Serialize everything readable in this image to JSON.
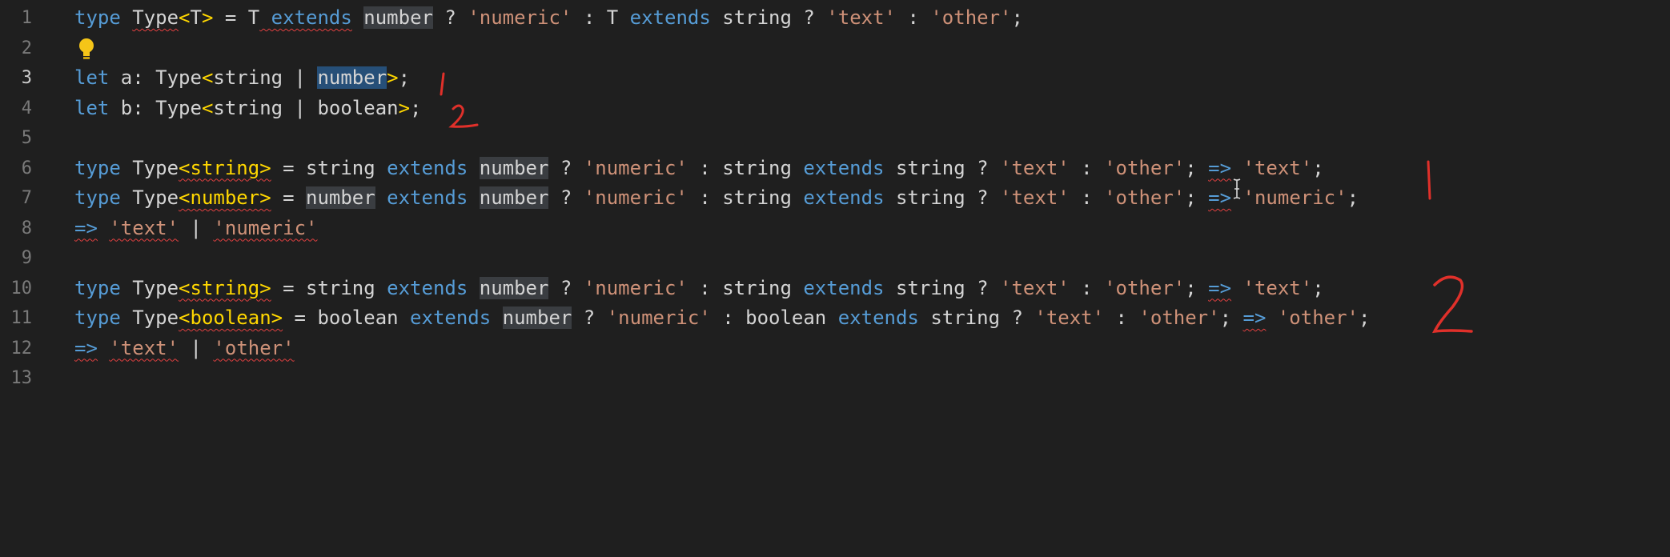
{
  "editor": {
    "top_partial_text": "- - - - - - -",
    "lines": [
      {
        "num": "1",
        "active": false,
        "segments": [
          {
            "t": "type",
            "c": "kw"
          },
          {
            "t": " "
          },
          {
            "t": "Type",
            "c": "tp sq"
          },
          {
            "t": "<",
            "c": "br"
          },
          {
            "t": "T",
            "c": "tp"
          },
          {
            "t": ">",
            "c": "br"
          },
          {
            "t": " = "
          },
          {
            "t": "T",
            "c": "tp"
          },
          {
            "t": " extends",
            "c": "kw sq"
          },
          {
            "t": " "
          },
          {
            "t": "number",
            "c": "hl"
          },
          {
            "t": " ? "
          },
          {
            "t": "'numeric'",
            "c": "str"
          },
          {
            "t": " : "
          },
          {
            "t": "T",
            "c": "tp"
          },
          {
            "t": " "
          },
          {
            "t": "extends",
            "c": "kw"
          },
          {
            "t": " string ? "
          },
          {
            "t": "'text'",
            "c": "str"
          },
          {
            "t": " : "
          },
          {
            "t": "'other'",
            "c": "str"
          },
          {
            "t": ";"
          }
        ]
      },
      {
        "num": "2",
        "active": false,
        "lightbulb": true,
        "segments": []
      },
      {
        "num": "3",
        "active": true,
        "segments": [
          {
            "t": "let",
            "c": "kw"
          },
          {
            "t": " a: "
          },
          {
            "t": "Type",
            "c": "tp"
          },
          {
            "t": "<",
            "c": "br"
          },
          {
            "t": "string | "
          },
          {
            "t": "number",
            "c": "sel"
          },
          {
            "t": ">",
            "c": "br"
          },
          {
            "t": ";"
          }
        ]
      },
      {
        "num": "4",
        "active": false,
        "segments": [
          {
            "t": "let",
            "c": "kw"
          },
          {
            "t": " b: "
          },
          {
            "t": "Type",
            "c": "tp"
          },
          {
            "t": "<",
            "c": "br"
          },
          {
            "t": "string | boolean"
          },
          {
            "t": ">",
            "c": "br"
          },
          {
            "t": ";"
          }
        ]
      },
      {
        "num": "5",
        "active": false,
        "segments": []
      },
      {
        "num": "6",
        "active": false,
        "segments": [
          {
            "t": "type",
            "c": "kw"
          },
          {
            "t": " "
          },
          {
            "t": "Type",
            "c": "tp"
          },
          {
            "t": "<string>",
            "c": "br sq"
          },
          {
            "t": " = string "
          },
          {
            "t": "extends",
            "c": "kw"
          },
          {
            "t": " "
          },
          {
            "t": "number",
            "c": "hl"
          },
          {
            "t": " ? "
          },
          {
            "t": "'numeric'",
            "c": "str"
          },
          {
            "t": " : string "
          },
          {
            "t": "extends",
            "c": "kw"
          },
          {
            "t": " string ? "
          },
          {
            "t": "'text'",
            "c": "str"
          },
          {
            "t": " : "
          },
          {
            "t": "'other'",
            "c": "str"
          },
          {
            "t": "; "
          },
          {
            "t": "=>",
            "c": "kw sq"
          },
          {
            "t": " "
          },
          {
            "t": "'text'",
            "c": "str"
          },
          {
            "t": ";"
          }
        ]
      },
      {
        "num": "7",
        "active": false,
        "segments": [
          {
            "t": "type",
            "c": "kw"
          },
          {
            "t": " "
          },
          {
            "t": "Type",
            "c": "tp"
          },
          {
            "t": "<number>",
            "c": "br sq"
          },
          {
            "t": " = "
          },
          {
            "t": "number",
            "c": "hl"
          },
          {
            "t": " "
          },
          {
            "t": "extends",
            "c": "kw"
          },
          {
            "t": " "
          },
          {
            "t": "number",
            "c": "hl"
          },
          {
            "t": " ? "
          },
          {
            "t": "'numeric'",
            "c": "str"
          },
          {
            "t": " : string "
          },
          {
            "t": "extends",
            "c": "kw"
          },
          {
            "t": " string ? "
          },
          {
            "t": "'text'",
            "c": "str"
          },
          {
            "t": " : "
          },
          {
            "t": "'other'",
            "c": "str"
          },
          {
            "t": "; "
          },
          {
            "t": "=>",
            "c": "kw sq"
          },
          {
            "t": " "
          },
          {
            "t": "'numeric'",
            "c": "str"
          },
          {
            "t": ";"
          }
        ]
      },
      {
        "num": "8",
        "active": false,
        "segments": [
          {
            "t": "=>",
            "c": "kw sq"
          },
          {
            "t": " "
          },
          {
            "t": "'text'",
            "c": "str sq"
          },
          {
            "t": " | "
          },
          {
            "t": "'numeric'",
            "c": "str sq"
          }
        ]
      },
      {
        "num": "9",
        "active": false,
        "segments": []
      },
      {
        "num": "10",
        "active": false,
        "segments": [
          {
            "t": "type",
            "c": "kw"
          },
          {
            "t": " "
          },
          {
            "t": "Type",
            "c": "tp"
          },
          {
            "t": "<string>",
            "c": "br sq"
          },
          {
            "t": " = string "
          },
          {
            "t": "extends",
            "c": "kw"
          },
          {
            "t": " "
          },
          {
            "t": "number",
            "c": "hl"
          },
          {
            "t": " ? "
          },
          {
            "t": "'numeric'",
            "c": "str"
          },
          {
            "t": " : string "
          },
          {
            "t": "extends",
            "c": "kw"
          },
          {
            "t": " string ? "
          },
          {
            "t": "'text'",
            "c": "str"
          },
          {
            "t": " : "
          },
          {
            "t": "'other'",
            "c": "str"
          },
          {
            "t": "; "
          },
          {
            "t": "=>",
            "c": "kw sq"
          },
          {
            "t": " "
          },
          {
            "t": "'text'",
            "c": "str"
          },
          {
            "t": ";"
          }
        ]
      },
      {
        "num": "11",
        "active": false,
        "segments": [
          {
            "t": "type",
            "c": "kw"
          },
          {
            "t": " "
          },
          {
            "t": "Type",
            "c": "tp"
          },
          {
            "t": "<boolean>",
            "c": "br sq"
          },
          {
            "t": " = boolean "
          },
          {
            "t": "extends",
            "c": "kw"
          },
          {
            "t": " "
          },
          {
            "t": "number",
            "c": "hl"
          },
          {
            "t": " ? "
          },
          {
            "t": "'numeric'",
            "c": "str"
          },
          {
            "t": " : boolean "
          },
          {
            "t": "extends",
            "c": "kw"
          },
          {
            "t": " string ? "
          },
          {
            "t": "'text'",
            "c": "str"
          },
          {
            "t": " : "
          },
          {
            "t": "'other'",
            "c": "str"
          },
          {
            "t": "; "
          },
          {
            "t": "=>",
            "c": "kw sq"
          },
          {
            "t": " "
          },
          {
            "t": "'other'",
            "c": "str"
          },
          {
            "t": ";"
          }
        ]
      },
      {
        "num": "12",
        "active": false,
        "segments": [
          {
            "t": "=>",
            "c": "kw sq"
          },
          {
            "t": " "
          },
          {
            "t": "'text'",
            "c": "str sq"
          },
          {
            "t": " | "
          },
          {
            "t": "'other'",
            "c": "str sq"
          }
        ]
      },
      {
        "num": "13",
        "active": false,
        "segments": []
      }
    ]
  },
  "annotations": {
    "color": "#e0302a",
    "marks": [
      "1",
      "2",
      "1",
      "2"
    ]
  },
  "icons": {
    "lightbulb": "lightbulb-icon",
    "cursor": "text-cursor-icon"
  }
}
